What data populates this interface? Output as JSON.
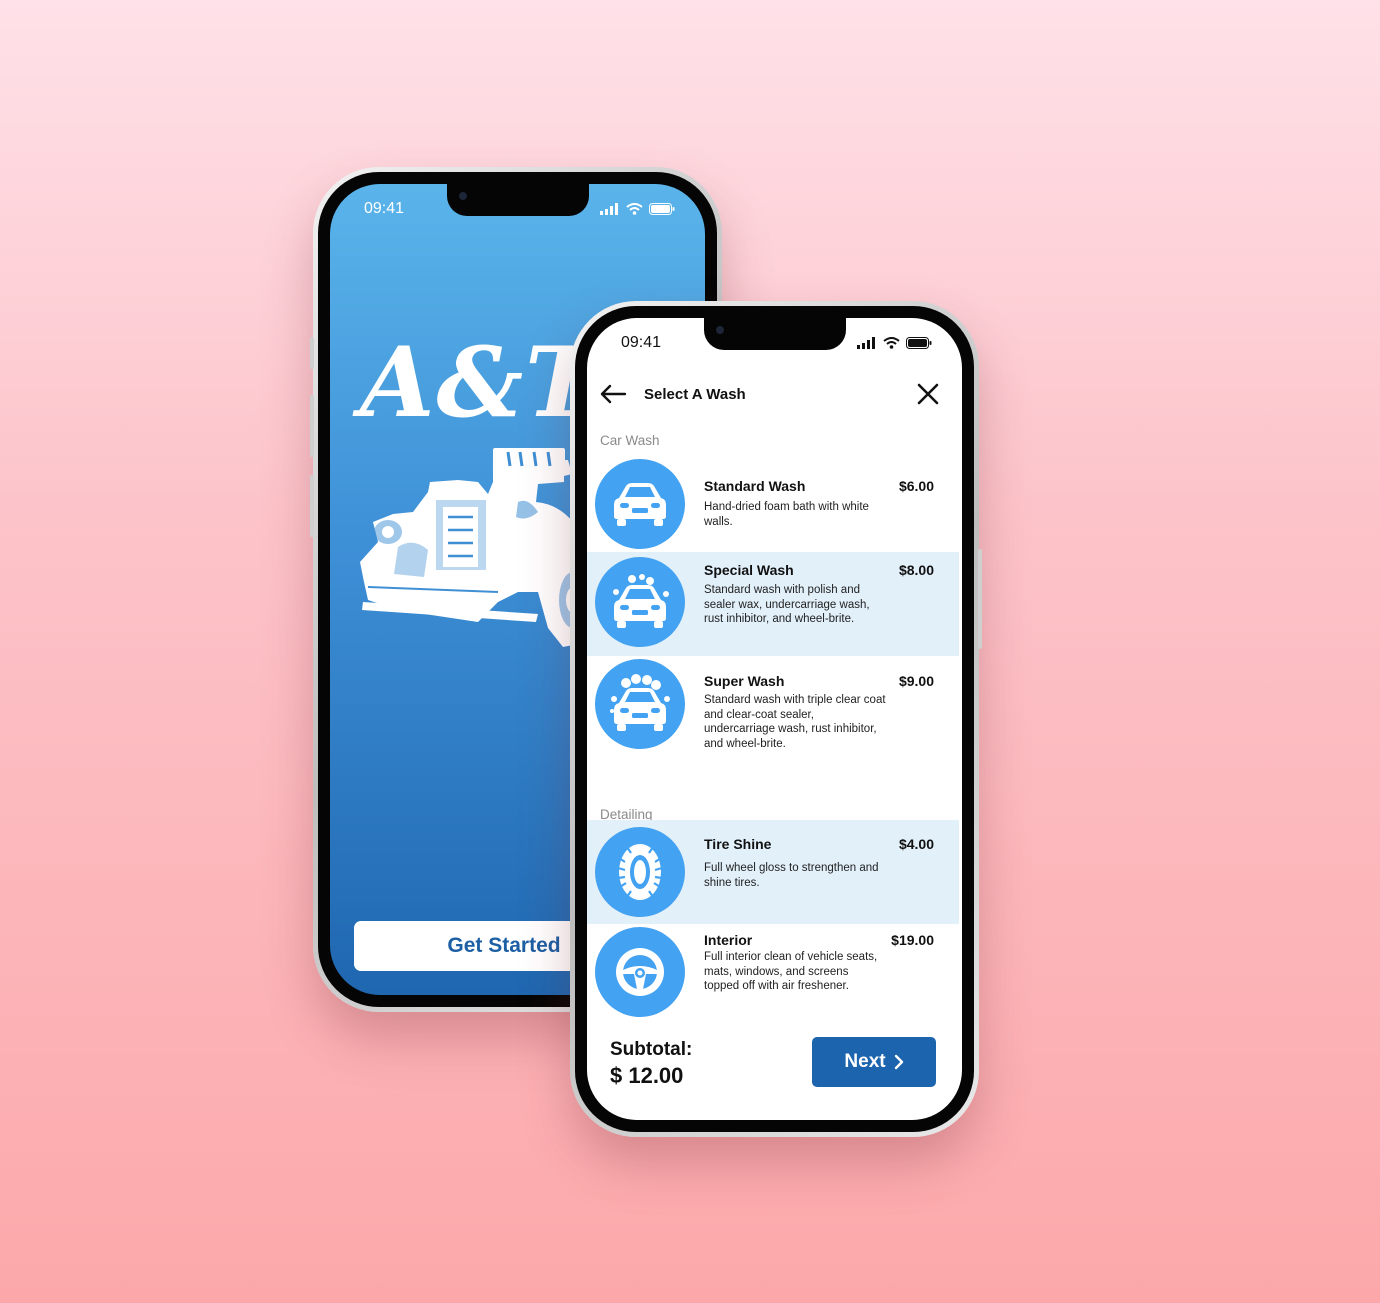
{
  "colors": {
    "accent": "#1d64ae",
    "icon_circle": "#43a2f2",
    "selected_row": "#e2f0fa",
    "splash_top": "#5ab4ea",
    "splash_bottom": "#1f67b0"
  },
  "splash_screen": {
    "status_time": "09:41",
    "brand": "A&T",
    "get_started_label": "Get Started"
  },
  "wash_screen": {
    "status_time": "09:41",
    "title": "Select A Wash",
    "sections": [
      {
        "label": "Car Wash",
        "items": [
          {
            "name": "Standard Wash",
            "price": "$6.00",
            "description": "Hand-dried foam bath with white walls.",
            "icon": "car-icon",
            "selected": false
          },
          {
            "name": "Special Wash",
            "price": "$8.00",
            "description": "Standard wash with polish and sealer wax, undercarriage wash, rust inhibitor, and wheel-brite.",
            "icon": "car-bubbles-icon",
            "selected": true
          },
          {
            "name": "Super Wash",
            "price": "$9.00",
            "description": "Standard wash with triple clear coat and clear-coat sealer, undercarriage wash, rust inhibitor, and wheel-brite.",
            "icon": "car-foam-icon",
            "selected": false
          }
        ]
      },
      {
        "label": "Detailing",
        "items": [
          {
            "name": "Tire Shine",
            "price": "$4.00",
            "description": "Full wheel gloss to strengthen and shine tires.",
            "icon": "tire-icon",
            "selected": true
          },
          {
            "name": "Interior",
            "price": "$19.00",
            "description": "Full interior clean of vehicle seats, mats, windows, and screens topped off with air freshener.",
            "icon": "steering-wheel-icon",
            "selected": false
          }
        ]
      }
    ],
    "subtotal_label": "Subtotal:",
    "subtotal_value": "$ 12.00",
    "next_label": "Next"
  }
}
